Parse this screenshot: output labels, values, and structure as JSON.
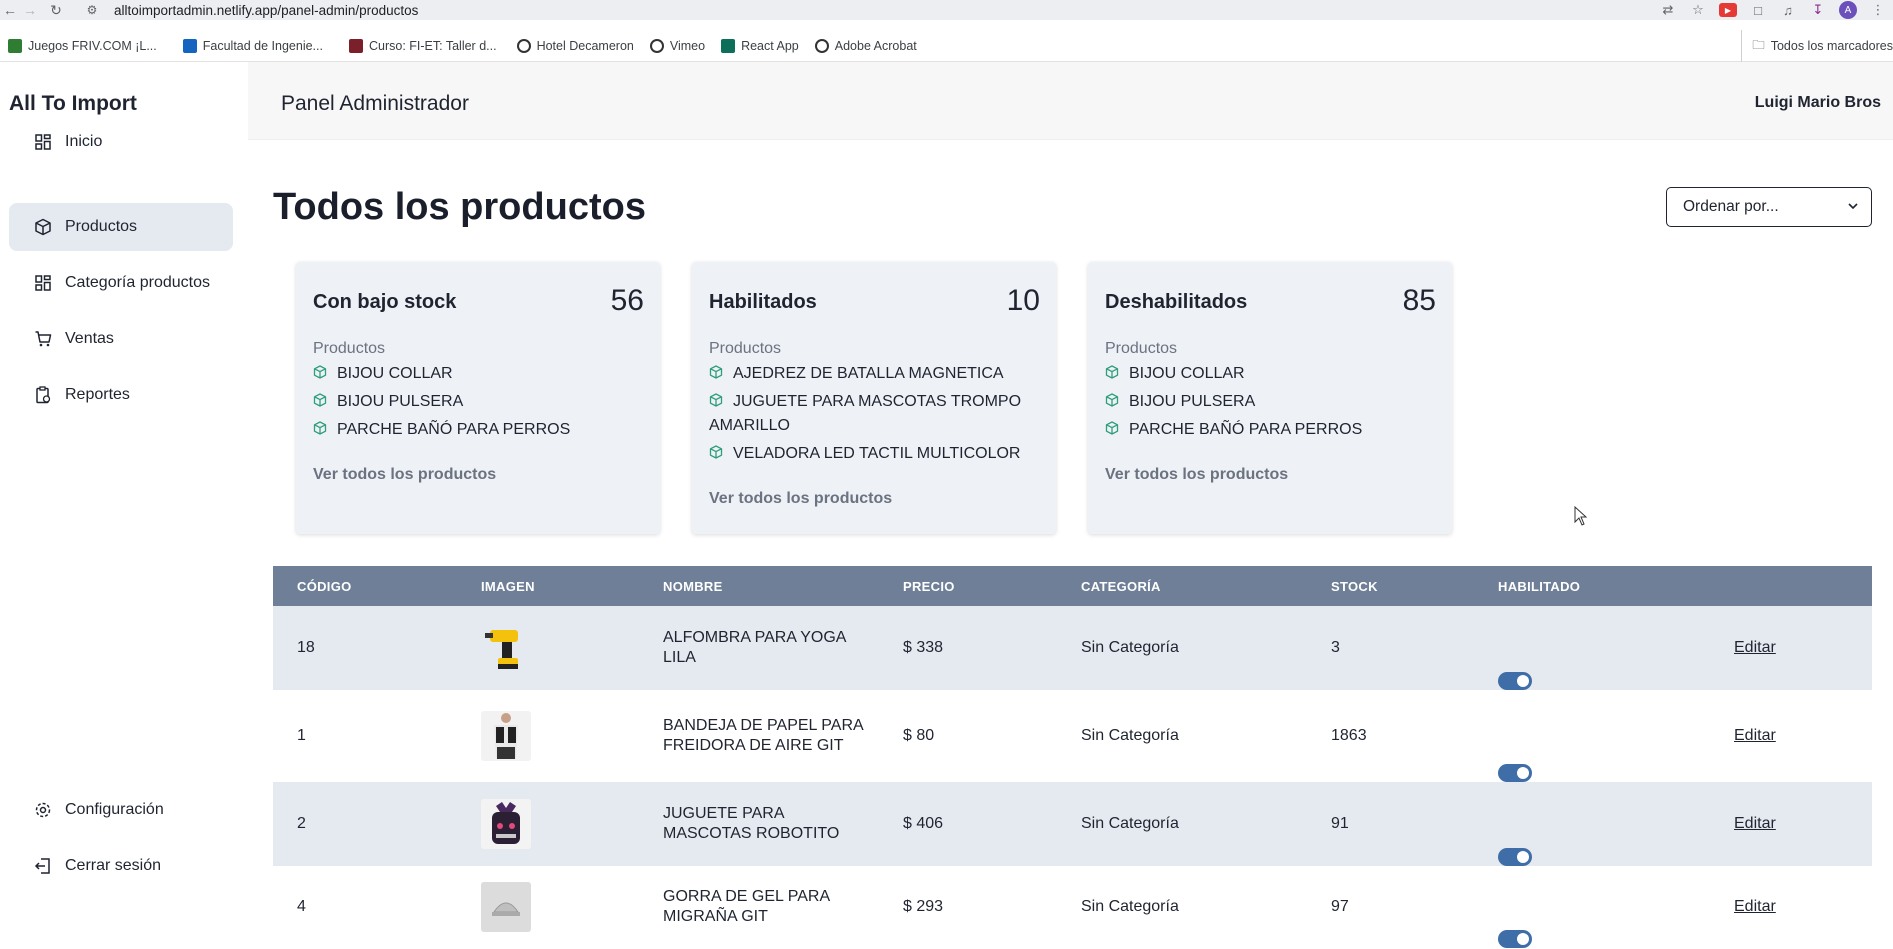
{
  "browser": {
    "url": "alltoimportadmin.netlify.app/panel-admin/productos",
    "profile_initial": "A"
  },
  "bookmarks": [
    {
      "label": "Juegos FRIV.COM ¡L...",
      "color": "#2e7d32"
    },
    {
      "label": "Facultad de Ingenie...",
      "color": "#1565c0"
    },
    {
      "label": "Curso: FI-ET: Taller d...",
      "color": "#7b1f2b"
    },
    {
      "label": "Hotel Decameron",
      "color": "#333333"
    },
    {
      "label": "Vimeo",
      "color": "#333333"
    },
    {
      "label": "React App",
      "color": "#0d6e5a"
    },
    {
      "label": "Adobe Acrobat",
      "color": "#333333"
    }
  ],
  "bookmarks_folder": "Todos los marcadores",
  "app": {
    "brand": "All To Import",
    "panel_title": "Panel Administrador",
    "user_name": "Luigi Mario Bros"
  },
  "sidebar": {
    "items": [
      {
        "label": "Inicio",
        "icon": "grid-icon"
      },
      {
        "label": "Productos",
        "icon": "box-icon",
        "active": true
      },
      {
        "label": "Categoría productos",
        "icon": "grid-icon"
      },
      {
        "label": "Ventas",
        "icon": "cart-icon"
      },
      {
        "label": "Reportes",
        "icon": "report-icon"
      }
    ],
    "bottom": [
      {
        "label": "Configuración",
        "icon": "gear-icon"
      },
      {
        "label": "Cerrar sesión",
        "icon": "logout-icon"
      }
    ]
  },
  "page": {
    "title": "Todos los productos",
    "sort_placeholder": "Ordenar por..."
  },
  "cards": [
    {
      "title": "Con bajo stock",
      "count": "56",
      "subtitle": "Productos",
      "items": [
        "BIJOU COLLAR",
        "BIJOU PULSERA",
        "PARCHE BAÑÓ PARA PERROS"
      ],
      "link": "Ver todos los productos"
    },
    {
      "title": "Habilitados",
      "count": "10",
      "subtitle": "Productos",
      "items": [
        "AJEDREZ DE BATALLA MAGNETICA",
        "JUGUETE PARA MASCOTAS TROMPO AMARILLO",
        "VELADORA LED TACTIL MULTICOLOR"
      ],
      "link": "Ver todos los productos"
    },
    {
      "title": "Deshabilitados",
      "count": "85",
      "subtitle": "Productos",
      "items": [
        "BIJOU COLLAR",
        "BIJOU PULSERA",
        "PARCHE BAÑÓ PARA PERROS"
      ],
      "link": "Ver todos los productos"
    }
  ],
  "table": {
    "headers": [
      "CÓDIGO",
      "IMAGEN",
      "NOMBRE",
      "PRECIO",
      "CATEGORÍA",
      "STOCK",
      "HABILITADO"
    ],
    "rows": [
      {
        "code": "18",
        "name": "ALFOMBRA PARA YOGA LILA",
        "price": "$ 338",
        "category": "Sin Categoría",
        "stock": "3",
        "enabled": true,
        "action": "Editar",
        "image": "drill-image"
      },
      {
        "code": "1",
        "name": "BANDEJA DE PAPEL PARA FREIDORA DE AIRE GIT",
        "price": "$ 80",
        "category": "Sin Categoría",
        "stock": "1863",
        "enabled": true,
        "action": "Editar",
        "image": "apron-image"
      },
      {
        "code": "2",
        "name": "JUGUETE PARA MASCOTAS ROBOTITO",
        "price": "$ 406",
        "category": "Sin Categoría",
        "stock": "91",
        "enabled": true,
        "action": "Editar",
        "image": "jar-image"
      },
      {
        "code": "4",
        "name": "GORRA DE GEL PARA MIGRAÑA GIT",
        "price": "$ 293",
        "category": "Sin Categoría",
        "stock": "97",
        "enabled": true,
        "action": "Editar",
        "image": "cap-image"
      }
    ]
  },
  "colors": {
    "accent": "#3f6da7",
    "table_header": "#6e7f97",
    "cube_green": "#2f9e7a",
    "active_nav": "#e5e9f0"
  }
}
